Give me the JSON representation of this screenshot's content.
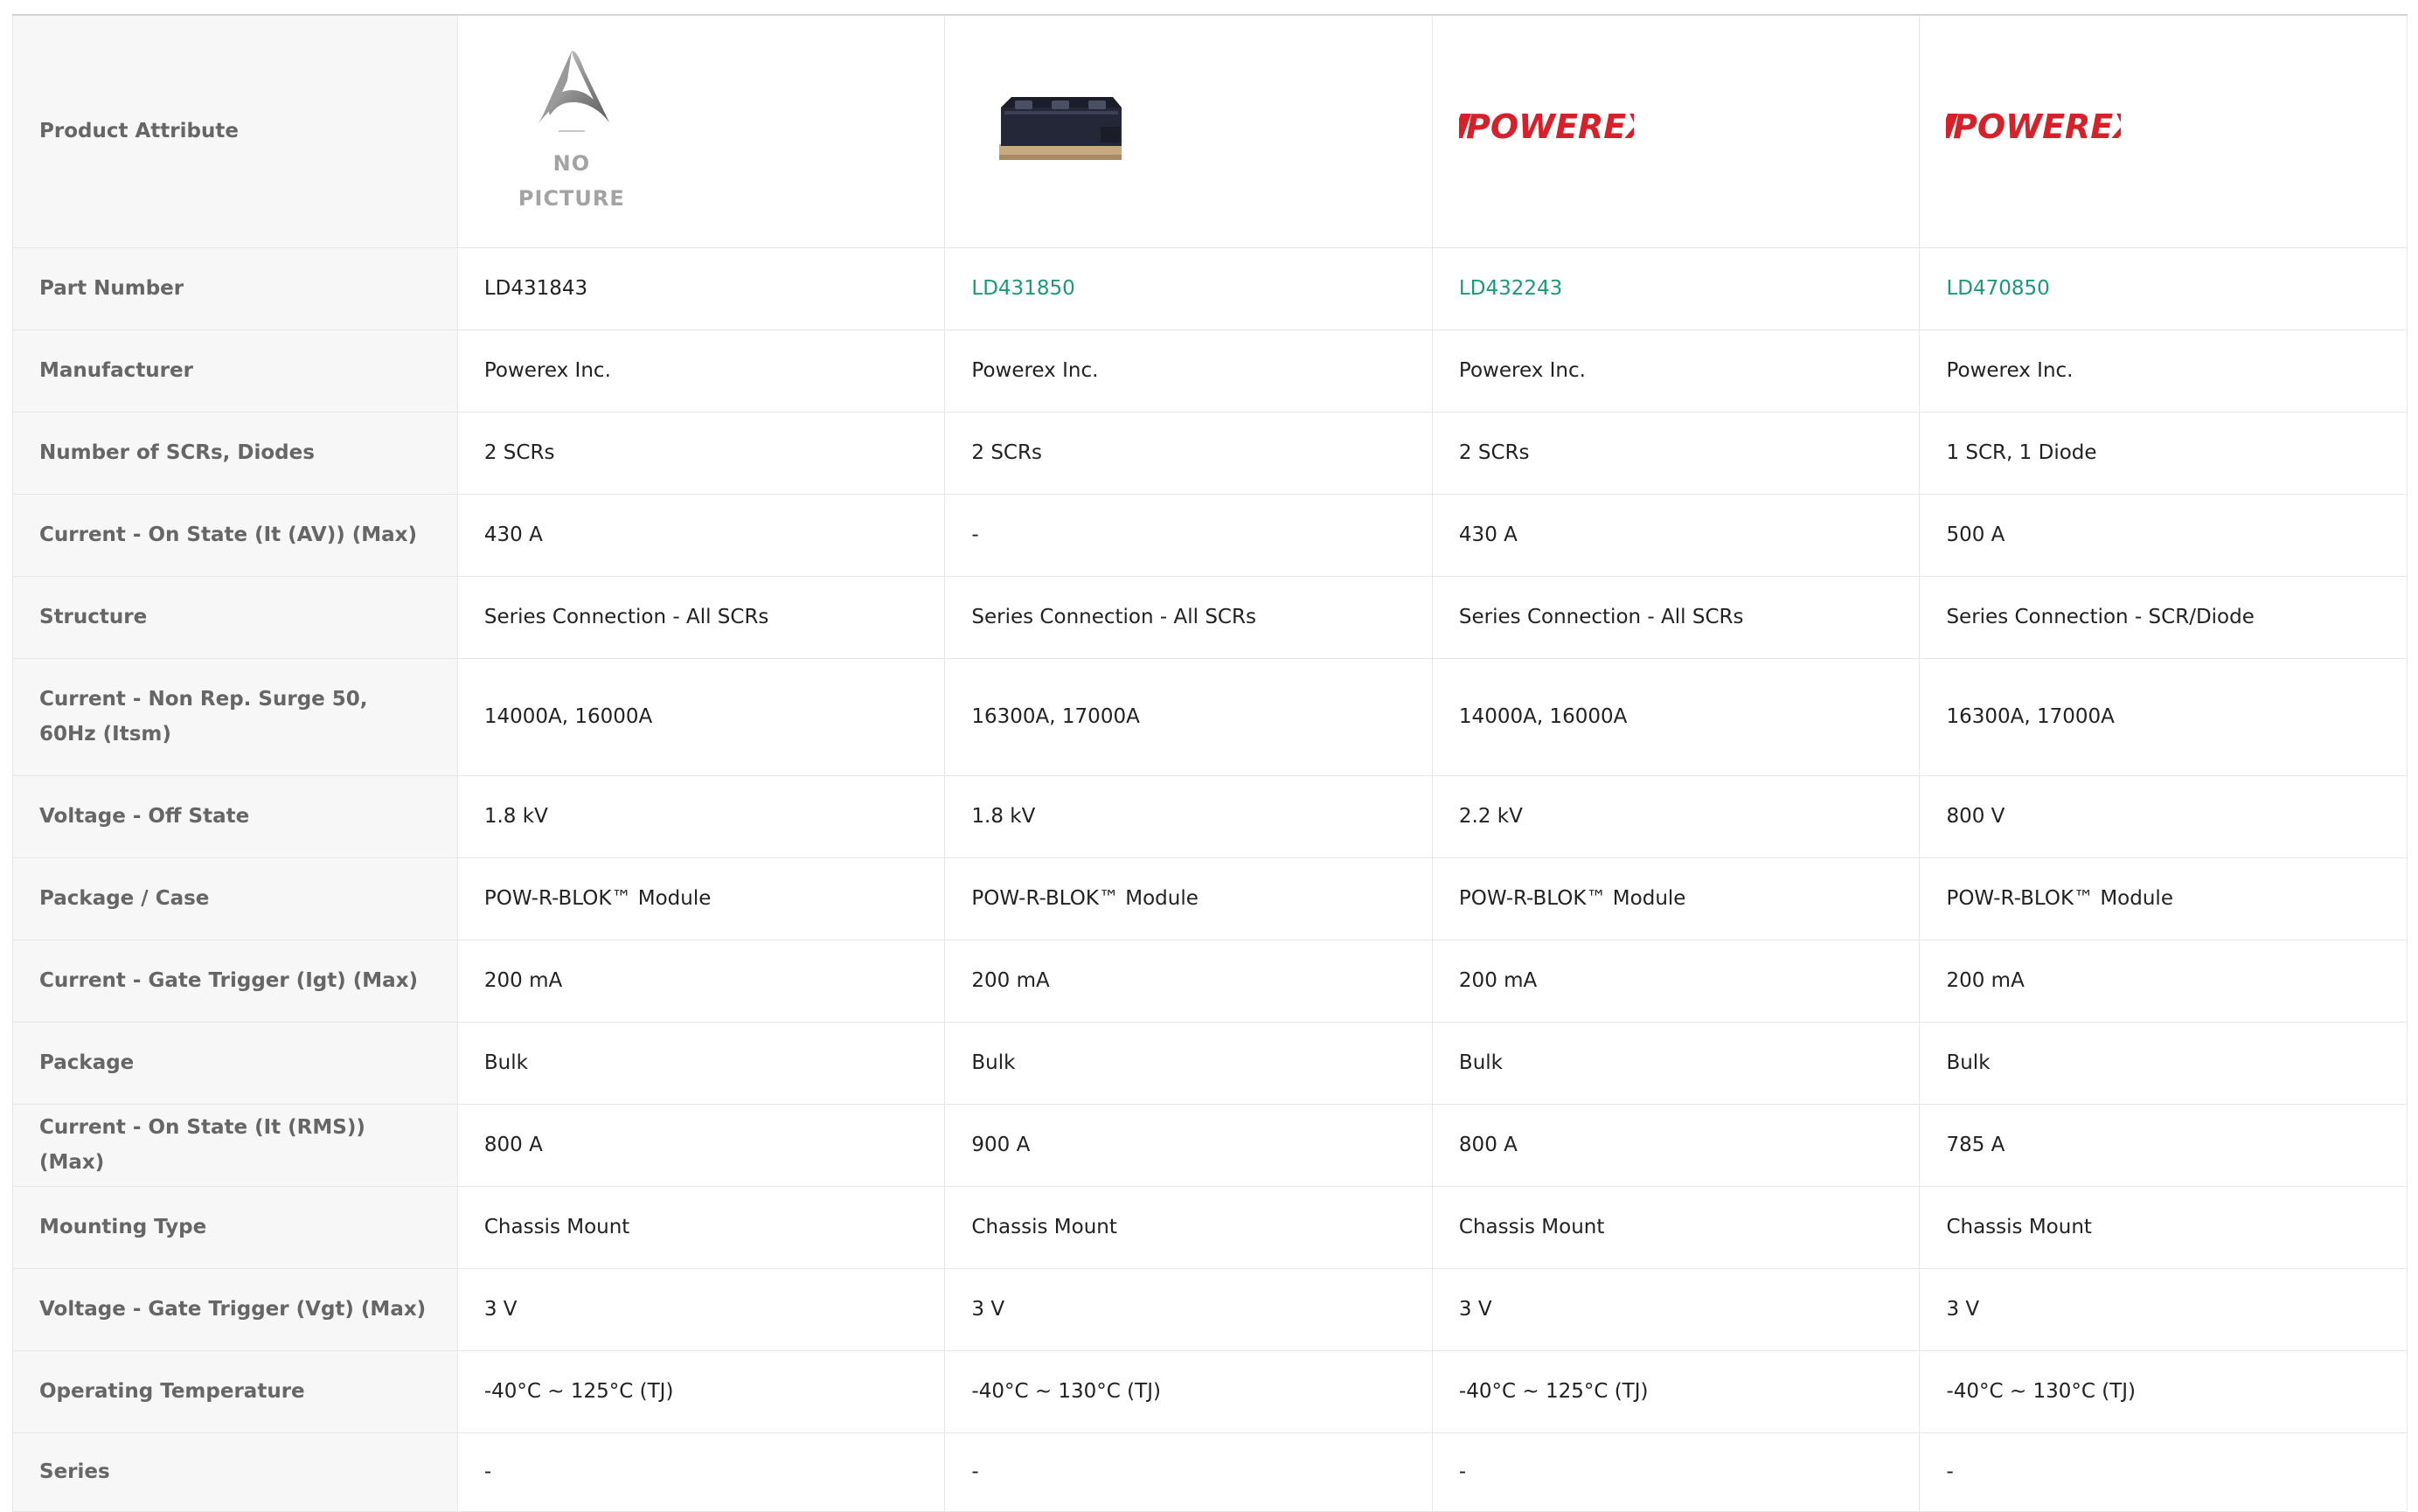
{
  "header_label": "Product Attribute",
  "no_picture_text": "NO PICTURE",
  "brand_logo_text": "POWEREX",
  "colors": {
    "link": "#1a9a7a",
    "logo_red": "#d6202a",
    "attr_bg": "#f7f7f7"
  },
  "products": [
    {
      "image": "no-picture",
      "part_number": "LD431843",
      "linked": false
    },
    {
      "image": "module-photo",
      "part_number": "LD431850",
      "linked": true
    },
    {
      "image": "powerex-logo",
      "part_number": "LD432243",
      "linked": true
    },
    {
      "image": "powerex-logo",
      "part_number": "LD470850",
      "linked": true
    }
  ],
  "part_number_label": "Part Number",
  "rows": [
    {
      "label": "Manufacturer",
      "values": [
        "Powerex Inc.",
        "Powerex Inc.",
        "Powerex Inc.",
        "Powerex Inc."
      ]
    },
    {
      "label": "Number of SCRs, Diodes",
      "values": [
        "2 SCRs",
        "2 SCRs",
        "2 SCRs",
        "1 SCR, 1 Diode"
      ]
    },
    {
      "label": "Current - On State (It (AV)) (Max)",
      "values": [
        "430 A",
        "-",
        "430 A",
        "500 A"
      ]
    },
    {
      "label": "Structure",
      "values": [
        "Series Connection - All SCRs",
        "Series Connection - All SCRs",
        "Series Connection - All SCRs",
        "Series Connection - SCR/Diode"
      ]
    },
    {
      "label": "Current - Non Rep. Surge 50, 60Hz (Itsm)",
      "values": [
        "14000A, 16000A",
        "16300A, 17000A",
        "14000A, 16000A",
        "16300A, 17000A"
      ]
    },
    {
      "label": "Voltage - Off State",
      "values": [
        "1.8 kV",
        "1.8 kV",
        "2.2 kV",
        "800 V"
      ]
    },
    {
      "label": "Package / Case",
      "values": [
        "POW-R-BLOK™ Module",
        "POW-R-BLOK™ Module",
        "POW-R-BLOK™ Module",
        "POW-R-BLOK™ Module"
      ]
    },
    {
      "label": "Current - Gate Trigger (Igt) (Max)",
      "values": [
        "200 mA",
        "200 mA",
        "200 mA",
        "200 mA"
      ]
    },
    {
      "label": "Package",
      "values": [
        "Bulk",
        "Bulk",
        "Bulk",
        "Bulk"
      ]
    },
    {
      "label": "Current - On State (It (RMS)) (Max)",
      "values": [
        "800 A",
        "900 A",
        "800 A",
        "785 A"
      ]
    },
    {
      "label": "Mounting Type",
      "values": [
        "Chassis Mount",
        "Chassis Mount",
        "Chassis Mount",
        "Chassis Mount"
      ]
    },
    {
      "label": "Voltage - Gate Trigger (Vgt) (Max)",
      "values": [
        "3 V",
        "3 V",
        "3 V",
        "3 V"
      ]
    },
    {
      "label": "Operating Temperature",
      "values": [
        "-40°C ~ 125°C (TJ)",
        "-40°C ~ 130°C (TJ)",
        "-40°C ~ 125°C (TJ)",
        "-40°C ~ 130°C (TJ)"
      ]
    },
    {
      "label": "Series",
      "values": [
        "-",
        "-",
        "-",
        "-"
      ]
    }
  ]
}
